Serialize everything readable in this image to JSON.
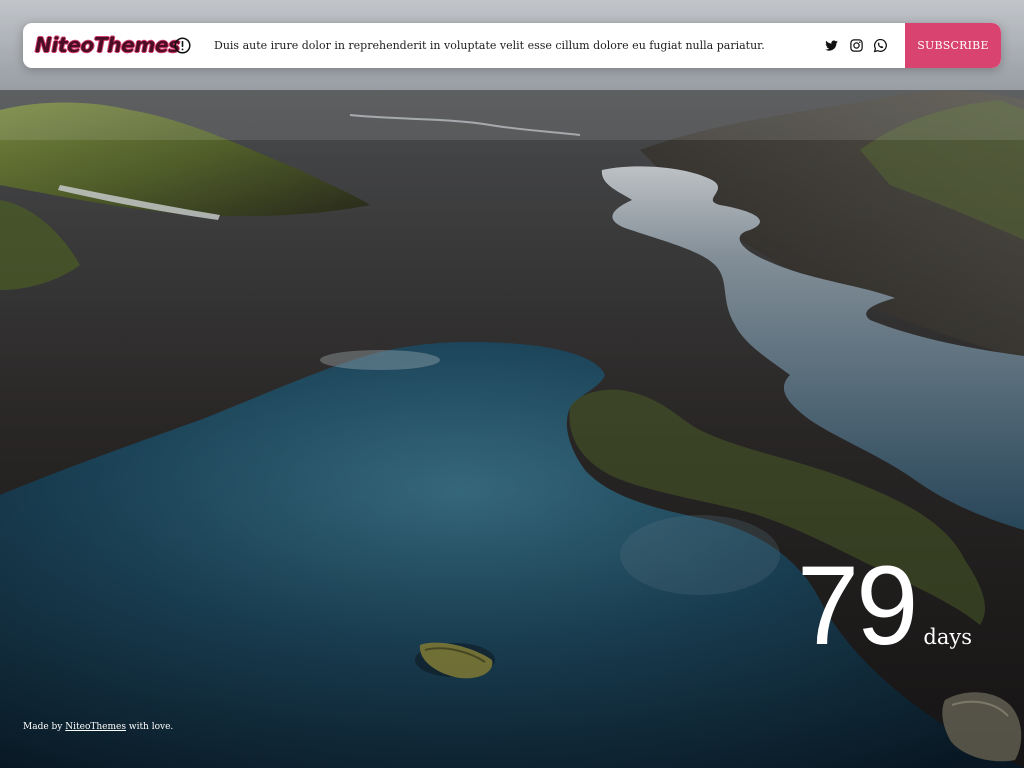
{
  "header": {
    "logo_text": "NiteoThemes",
    "announcement": "Duis aute irure dolor in reprehenderit in voluptate velit esse cillum dolore eu fugiat nulla pariatur.",
    "subscribe_label": "SUBSCRIBE",
    "info_icon": "exclamation-circle-icon",
    "social": [
      "twitter-icon",
      "instagram-icon",
      "whatsapp-icon"
    ]
  },
  "countdown": {
    "value": "79",
    "unit": "days"
  },
  "footer": {
    "prefix": "Made by",
    "link_text": "NiteoThemes",
    "suffix": "with love."
  },
  "colors": {
    "accent": "#d9436f",
    "logo": "#4a0d26",
    "topbar_bg": "#ffffff",
    "text_light": "#ffffff"
  }
}
